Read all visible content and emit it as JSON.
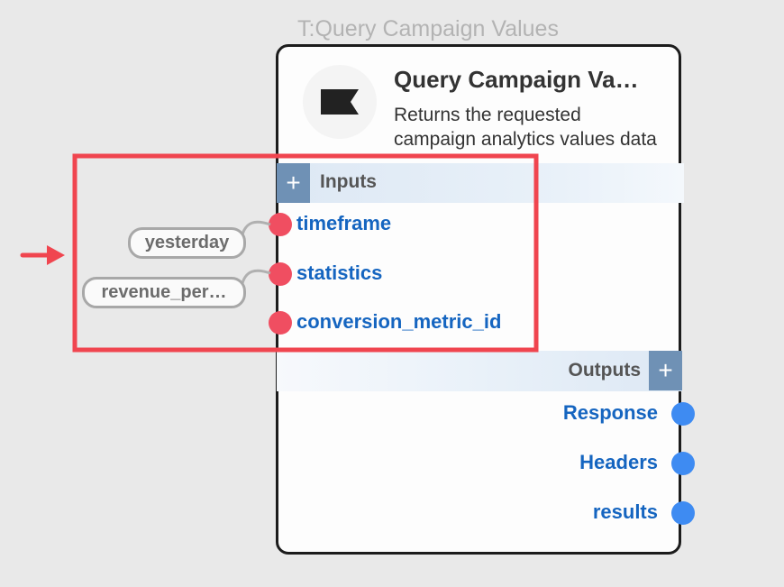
{
  "node": {
    "outside_title": "T:Query Campaign Values",
    "heading": "Query Campaign Va…",
    "description": "Returns the requested campaign analytics values data",
    "logo_icon": "flag-icon"
  },
  "inputs": {
    "label": "Inputs",
    "add_icon": "+",
    "ports": [
      {
        "name": "timeframe",
        "value": "yesterday"
      },
      {
        "name": "statistics",
        "value": "revenue_per…"
      },
      {
        "name": "conversion_metric_id",
        "value": ""
      }
    ]
  },
  "outputs": {
    "label": "Outputs",
    "add_icon": "+",
    "ports": [
      {
        "name": "Response"
      },
      {
        "name": "Headers"
      },
      {
        "name": "results"
      }
    ]
  },
  "colors": {
    "input_port": "#f04e61",
    "output_port": "#3e8bf2",
    "highlight": "#f0454f",
    "port_label": "#1565c0"
  }
}
